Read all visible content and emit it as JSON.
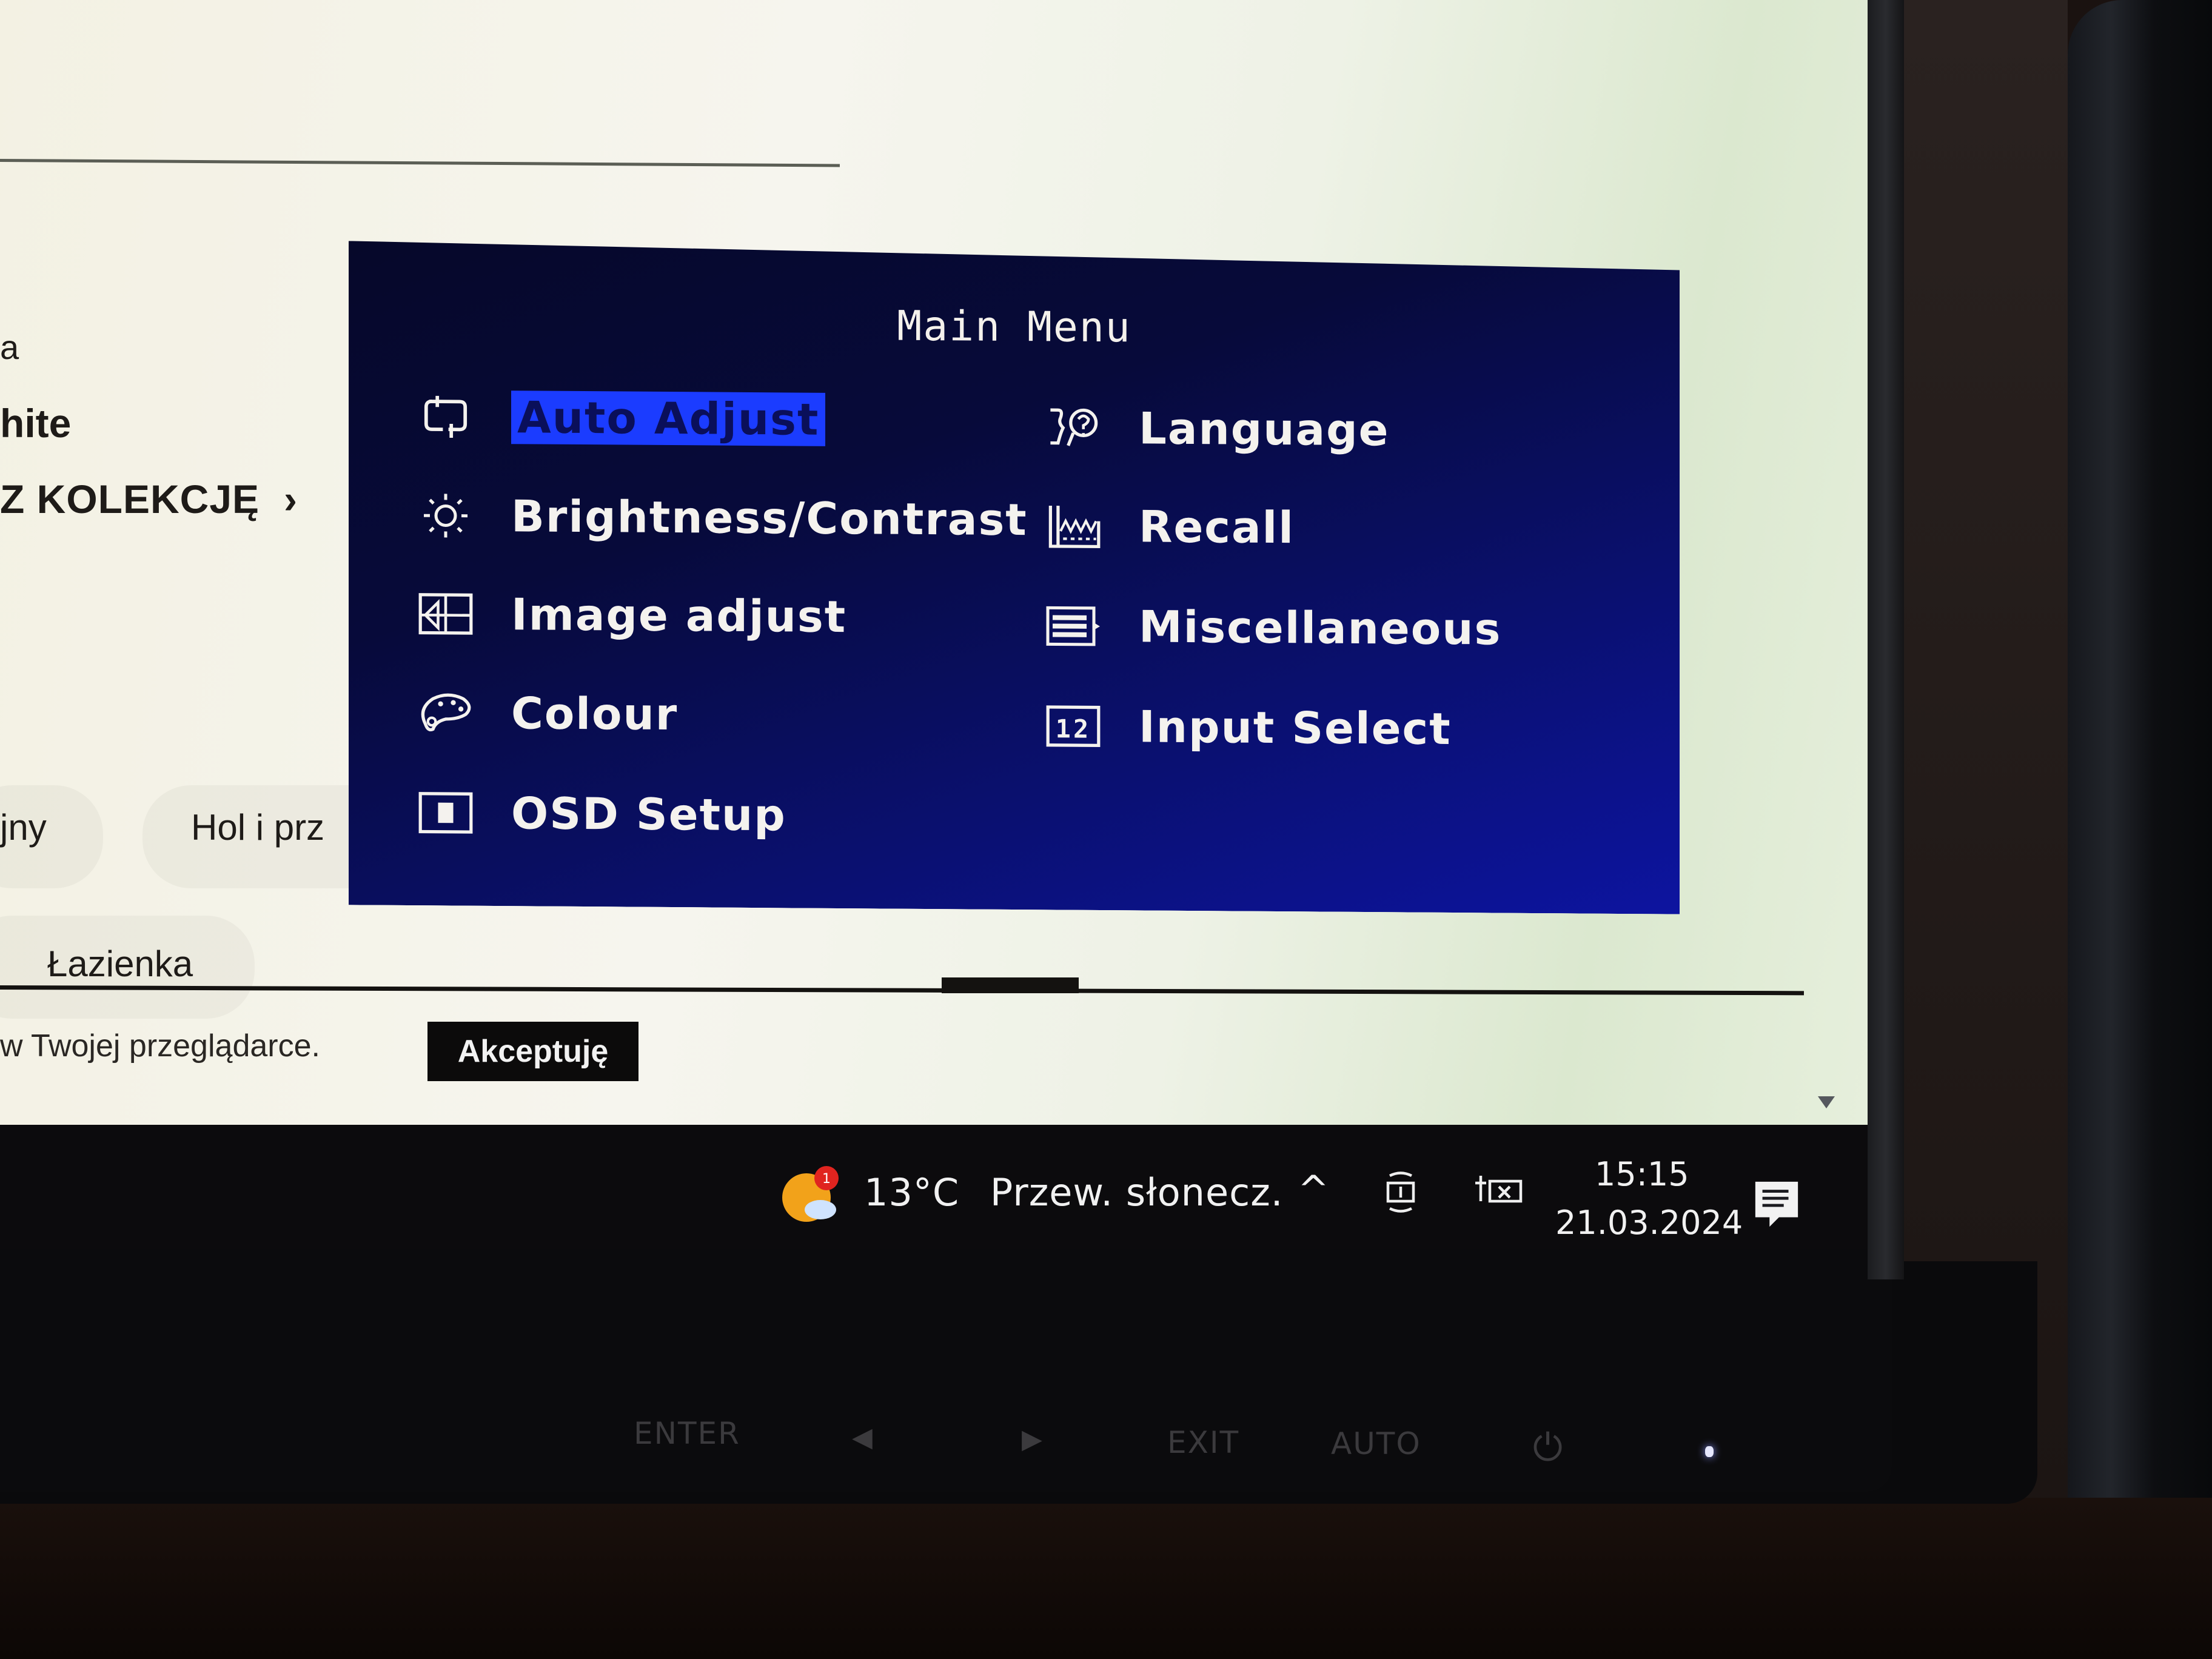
{
  "webpage": {
    "fragment_top": "a",
    "fragment_product": "hite",
    "fragment_collection_link": "Z KOLEKCJĘ",
    "collection_chevron": "›",
    "category_tabs": [
      {
        "label": "jny"
      },
      {
        "label": "Hol i prz"
      },
      {
        "label": "Łazienka"
      }
    ],
    "cookie_text": "w Twojej przeglądarce.",
    "accept_button": "Akceptuję"
  },
  "osd": {
    "title": "Main Menu",
    "selected": "Auto Adjust",
    "left_items": [
      {
        "label": "Auto Adjust",
        "icon": "auto-adjust-icon"
      },
      {
        "label": "Brightness/Contrast",
        "icon": "brightness-icon"
      },
      {
        "label": "Image adjust",
        "icon": "image-adjust-icon"
      },
      {
        "label": "Colour",
        "icon": "palette-icon"
      },
      {
        "label": "OSD Setup",
        "icon": "osd-setup-icon"
      }
    ],
    "right_items": [
      {
        "label": "Language",
        "icon": "language-icon"
      },
      {
        "label": "Recall",
        "icon": "recall-icon"
      },
      {
        "label": "Miscellaneous",
        "icon": "miscellaneous-icon"
      },
      {
        "label": "Input Select",
        "icon": "input-select-icon"
      }
    ],
    "colors": {
      "background": "#0a1070",
      "highlight": "#1b3cff",
      "text": "#f4f2ee"
    }
  },
  "taskbar": {
    "weather_temp": "13°C",
    "weather_desc": "Przew. słonecz.",
    "weather_badge": "1",
    "tray_chevron": "^",
    "time": "15:15",
    "date": "21.03.2024"
  },
  "monitor_buttons": {
    "enter": "ENTER",
    "left": "◀",
    "right": "▶",
    "exit": "EXIT",
    "auto": "AUTO",
    "power": "⏻"
  }
}
